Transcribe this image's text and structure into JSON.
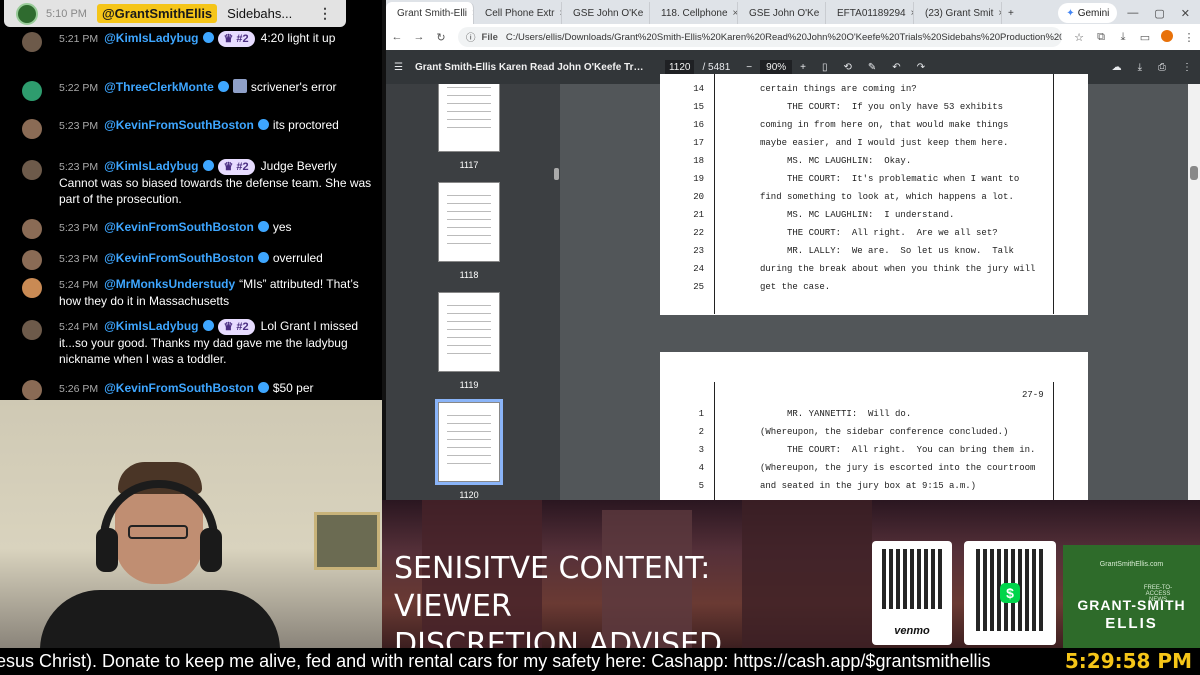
{
  "chat": {
    "pinned": {
      "time": "5:10 PM",
      "user": "@GrantSmithEllis",
      "text": "Sidebahs..."
    },
    "messages": [
      {
        "time": "5:21 PM",
        "user": "@KimIsLadybug",
        "pill": "#2",
        "text": "4:20 light it up"
      },
      {
        "time": "5:22 PM",
        "user": "@ThreeClerkMonte",
        "pill": "",
        "text": "scrivener's error"
      },
      {
        "time": "5:23 PM",
        "user": "@KevinFromSouthBoston",
        "pill": "",
        "text": "its proctored"
      },
      {
        "time": "5:23 PM",
        "user": "@KimIsLadybug",
        "pill": "#2",
        "text": "Judge Beverly Cannot was so biased towards the defense team. She was part of the prosecution."
      },
      {
        "time": "5:23 PM",
        "user": "@KevinFromSouthBoston",
        "pill": "",
        "text": "yes"
      },
      {
        "time": "5:23 PM",
        "user": "@KevinFromSouthBoston",
        "pill": "",
        "text": "overruled"
      },
      {
        "time": "5:24 PM",
        "user": "@MrMonksUnderstudy",
        "pill": "",
        "text": "“MIs” attributed! That’s how they do it in Massachusetts"
      },
      {
        "time": "5:24 PM",
        "user": "@KimIsLadybug",
        "pill": "#2",
        "text": "Lol Grant I missed it...so your good. Thanks my dad gave me the ladybug nickname when I was a toddler."
      },
      {
        "time": "5:26 PM",
        "user": "@KevinFromSouthBoston",
        "pill": "",
        "text": "$50 per"
      }
    ]
  },
  "browser": {
    "tabs": [
      {
        "label": "Grant Smith-Elli",
        "icon": "pdf",
        "color": "#e53935"
      },
      {
        "label": "Cell Phone Extr",
        "icon": "drive",
        "color": "#34a853"
      },
      {
        "label": "GSE John O'Ke",
        "icon": "drive",
        "color": "#4285f4"
      },
      {
        "label": "118. Cellphone",
        "icon": "drive",
        "color": "#fbbc04"
      },
      {
        "label": "GSE John O'Ke",
        "icon": "drive",
        "color": "#4285f4"
      },
      {
        "label": "EFTA01189294",
        "icon": "web",
        "color": "#555"
      },
      {
        "label": "(23) Grant Smit",
        "icon": "x",
        "color": "#000"
      }
    ],
    "gemini_label": "Gemini",
    "url_label": "File",
    "url": "C:/Users/ellis/Downloads/Grant%20Smith-Ellis%20Karen%20Read%20John%20O'Keefe%20Trials%20Sidebahs%20Production%202%20Full%202...",
    "pdf_title": "Grant Smith-Ellis Karen Read John O'Keefe Trials Sidebahs Pr...",
    "page_current": "1120",
    "page_total": "/ 5481",
    "zoom": "90%",
    "thumb_labels": [
      "1117",
      "1118",
      "1119",
      "1120"
    ],
    "page1_lines": [
      {
        "n": "14",
        "t": "certain things are coming in?"
      },
      {
        "n": "15",
        "t": "     THE COURT:  If you only have 53 exhibits"
      },
      {
        "n": "16",
        "t": "coming in from here on, that would make things"
      },
      {
        "n": "17",
        "t": "maybe easier, and I would just keep them here."
      },
      {
        "n": "18",
        "t": "     MS. MC LAUGHLIN:  Okay."
      },
      {
        "n": "19",
        "t": "     THE COURT:  It's problematic when I want to"
      },
      {
        "n": "20",
        "t": "find something to look at, which happens a lot."
      },
      {
        "n": "21",
        "t": "     MS. MC LAUGHLIN:  I understand."
      },
      {
        "n": "22",
        "t": "     THE COURT:  All right.  Are we all set?"
      },
      {
        "n": "23",
        "t": "     MR. LALLY:  We are.  So let us know.  Talk"
      },
      {
        "n": "24",
        "t": "during the break about when you think the jury will"
      },
      {
        "n": "25",
        "t": "get the case."
      }
    ],
    "page2_number": "27-9",
    "page2_lines": [
      {
        "n": "1",
        "t": "     MR. YANNETTI:  Will do."
      },
      {
        "n": "2",
        "t": "(Whereupon, the sidebar conference concluded.)"
      },
      {
        "n": "3",
        "t": "     THE COURT:  All right.  You can bring them in."
      },
      {
        "n": "4",
        "t": "(Whereupon, the jury is escorted into the courtroom"
      },
      {
        "n": "5",
        "t": "and seated in the jury box at 9:15 a.m.)"
      }
    ]
  },
  "overlay": {
    "warning_line1": "SENISITVE CONTENT: VIEWER",
    "warning_line2": "DISCRETION ADVISED",
    "venmo_label": "venmo",
    "cashapp_symbol": "$",
    "logo_line1": "GRANT-SMITH",
    "logo_line2": "ELLIS",
    "logo_arc": "GrantSmithEllis.com",
    "logo_tag": "FREE-TO-ACCESS NEWS",
    "brand_green": "#2e6b2a"
  },
  "ticker": {
    "text": "esus Christ). Donate to keep me alive, fed and with rental cars for my safety here: Cashapp: https://cash.app/$grantsmithellis",
    "clock": "5:29:58 PM"
  }
}
